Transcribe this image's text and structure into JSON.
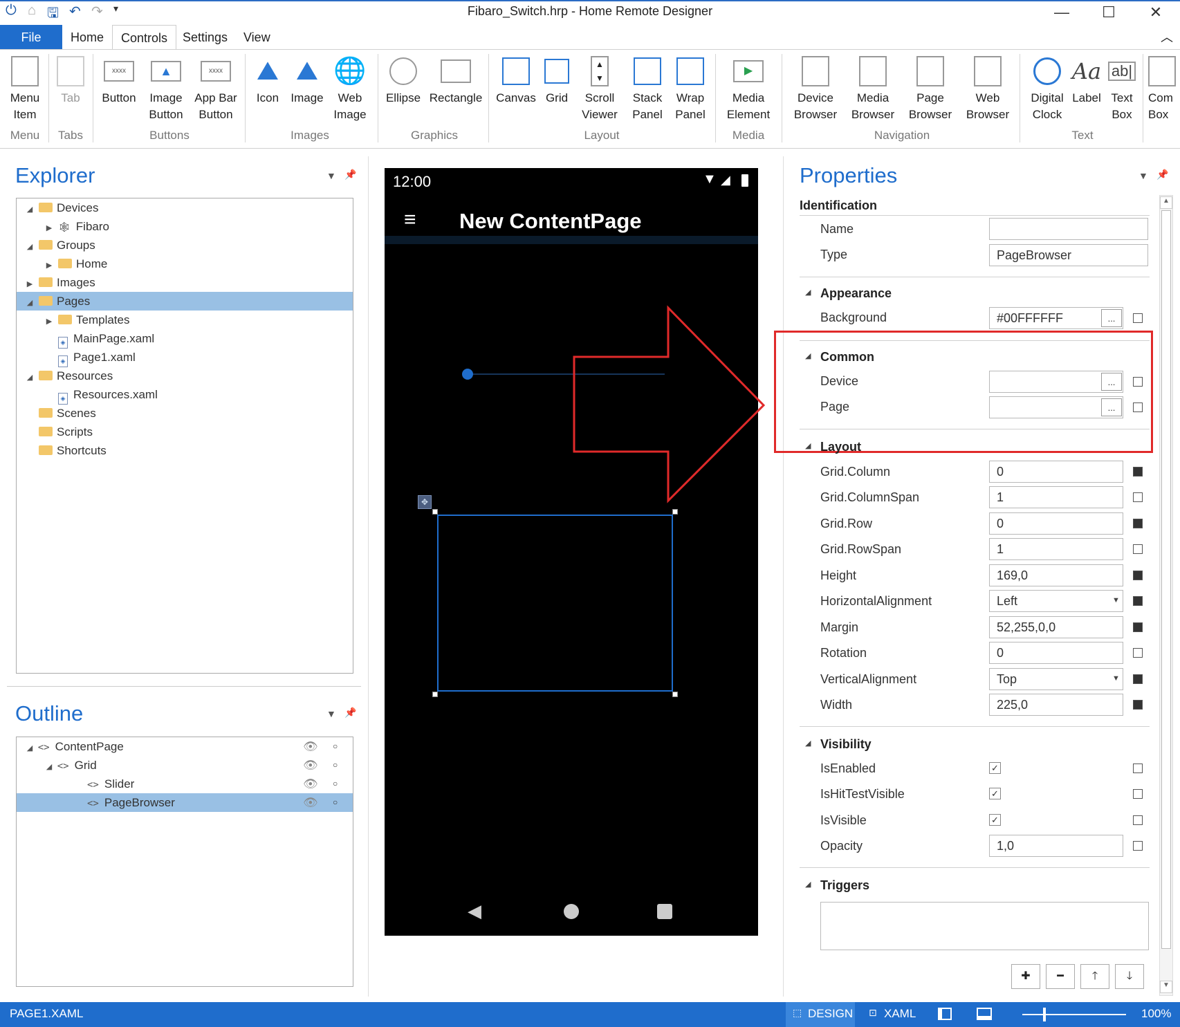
{
  "window": {
    "title": "Fibaro_Switch.hrp - Home Remote Designer",
    "minimize": "—",
    "maximize": "☐",
    "close": "✕"
  },
  "ribbon_tabs": [
    "File",
    "Home",
    "Controls",
    "Settings",
    "View"
  ],
  "ribbon": {
    "groups": [
      {
        "label": "Menu",
        "buttons": [
          {
            "label": "Menu Item",
            "icon": "menu-item-icon"
          }
        ]
      },
      {
        "label": "Tabs",
        "buttons": [
          {
            "label": "Tab",
            "icon": "tab-icon"
          }
        ]
      },
      {
        "label": "Buttons",
        "buttons": [
          {
            "label": "Button",
            "icon": "button-icon"
          },
          {
            "label": "Image Button",
            "icon": "image-button-icon"
          },
          {
            "label": "App Bar Button",
            "icon": "app-bar-button-icon"
          }
        ]
      },
      {
        "label": "Images",
        "buttons": [
          {
            "label": "Icon",
            "icon": "icon-icon"
          },
          {
            "label": "Image",
            "icon": "image-icon"
          },
          {
            "label": "Web Image",
            "icon": "web-image-icon"
          }
        ]
      },
      {
        "label": "Graphics",
        "buttons": [
          {
            "label": "Ellipse",
            "icon": "ellipse-icon"
          },
          {
            "label": "Rectangle",
            "icon": "rectangle-icon"
          }
        ]
      },
      {
        "label": "Layout",
        "buttons": [
          {
            "label": "Canvas",
            "icon": "canvas-icon"
          },
          {
            "label": "Grid",
            "icon": "grid-icon"
          },
          {
            "label": "Scroll Viewer",
            "icon": "scroll-viewer-icon"
          },
          {
            "label": "Stack Panel",
            "icon": "stack-panel-icon"
          },
          {
            "label": "Wrap Panel",
            "icon": "wrap-panel-icon"
          }
        ]
      },
      {
        "label": "Media",
        "buttons": [
          {
            "label": "Media Element",
            "icon": "media-element-icon"
          }
        ]
      },
      {
        "label": "Navigation",
        "buttons": [
          {
            "label": "Device Browser",
            "icon": "device-browser-icon"
          },
          {
            "label": "Media Browser",
            "icon": "media-browser-icon"
          },
          {
            "label": "Page Browser",
            "icon": "page-browser-icon"
          },
          {
            "label": "Web Browser",
            "icon": "web-browser-icon"
          }
        ]
      },
      {
        "label": "Text",
        "buttons": [
          {
            "label": "Digital Clock",
            "icon": "digital-clock-icon"
          },
          {
            "label": "Label",
            "icon": "label-icon"
          },
          {
            "label": "Text Box",
            "icon": "text-box-icon"
          },
          {
            "label": "Com Box",
            "icon": "combo-box-icon"
          }
        ]
      }
    ],
    "btn": {
      "menu_item_1": "Menu",
      "menu_item_2": "Item",
      "tab": "Tab",
      "button": "Button",
      "image_button_1": "Image",
      "image_button_2": "Button",
      "app_bar_1": "App Bar",
      "app_bar_2": "Button",
      "icon": "Icon",
      "image": "Image",
      "web_image_1": "Web",
      "web_image_2": "Image",
      "ellipse": "Ellipse",
      "rectangle": "Rectangle",
      "canvas": "Canvas",
      "grid": "Grid",
      "scroll_1": "Scroll",
      "scroll_2": "Viewer",
      "stack_1": "Stack",
      "stack_2": "Panel",
      "wrap_1": "Wrap",
      "wrap_2": "Panel",
      "media_1": "Media",
      "media_2": "Element",
      "device_1": "Device",
      "device_2": "Browser",
      "mediab_1": "Media",
      "mediab_2": "Browser",
      "page_1": "Page",
      "page_2": "Browser",
      "web_1": "Web",
      "web_2": "Browser",
      "clock_1": "Digital",
      "clock_2": "Clock",
      "label": "Label",
      "textbox_1": "Text",
      "textbox_2": "Box",
      "combo_1": "Com",
      "combo_2": "Box",
      "xxxx": "xxxx",
      "aa": "Aa",
      "ab": "ab|"
    }
  },
  "explorer": {
    "title": "Explorer",
    "items": [
      {
        "label": "Devices"
      },
      {
        "label": "Fibaro"
      },
      {
        "label": "Groups"
      },
      {
        "label": "Home"
      },
      {
        "label": "Images"
      },
      {
        "label": "Pages"
      },
      {
        "label": "Templates"
      },
      {
        "label": "MainPage.xaml"
      },
      {
        "label": "Page1.xaml"
      },
      {
        "label": "Resources"
      },
      {
        "label": "Resources.xaml"
      },
      {
        "label": "Scenes"
      },
      {
        "label": "Scripts"
      },
      {
        "label": "Shortcuts"
      }
    ]
  },
  "outline": {
    "title": "Outline",
    "items": [
      {
        "label": "ContentPage"
      },
      {
        "label": "Grid"
      },
      {
        "label": "Slider"
      },
      {
        "label": "PageBrowser"
      }
    ],
    "tag_glyph": "<>"
  },
  "phone": {
    "time": "12:00",
    "page_title": "New ContentPage",
    "slider_value": 0.0
  },
  "properties": {
    "title": "Properties",
    "sections": {
      "identification": "Identification",
      "appearance": "Appearance",
      "common": "Common",
      "layout": "Layout",
      "visibility": "Visibility",
      "triggers": "Triggers"
    },
    "labels": {
      "name": "Name",
      "type": "Type",
      "background": "Background",
      "device": "Device",
      "page": "Page",
      "grid_column": "Grid.Column",
      "grid_columnspan": "Grid.ColumnSpan",
      "grid_row": "Grid.Row",
      "grid_rowspan": "Grid.RowSpan",
      "height": "Height",
      "halign": "HorizontalAlignment",
      "margin": "Margin",
      "rotation": "Rotation",
      "valign": "VerticalAlignment",
      "width": "Width",
      "isenabled": "IsEnabled",
      "ishittestvisible": "IsHitTestVisible",
      "isvisible": "IsVisible",
      "opacity": "Opacity"
    },
    "values": {
      "name": "",
      "type": "PageBrowser",
      "background": "#00FFFFFF",
      "device": "",
      "page": "",
      "grid_column": "0",
      "grid_columnspan": "1",
      "grid_row": "0",
      "grid_rowspan": "1",
      "height": "169,0",
      "halign": "Left",
      "margin": "52,255,0,0",
      "rotation": "0",
      "valign": "Top",
      "width": "225,0",
      "opacity": "1,0",
      "dots": "...",
      "check": "✓"
    },
    "trigger_buttons": [
      "✚",
      "━",
      "🡑",
      "🡓"
    ]
  },
  "statusbar": {
    "file": "PAGE1.XAML",
    "design": "DESIGN",
    "xaml": "XAML",
    "zoom": "100%"
  },
  "colors": {
    "accent": "#1f6dcc",
    "highlight_red": "#e02a2a",
    "selection": "#99c0e4"
  }
}
